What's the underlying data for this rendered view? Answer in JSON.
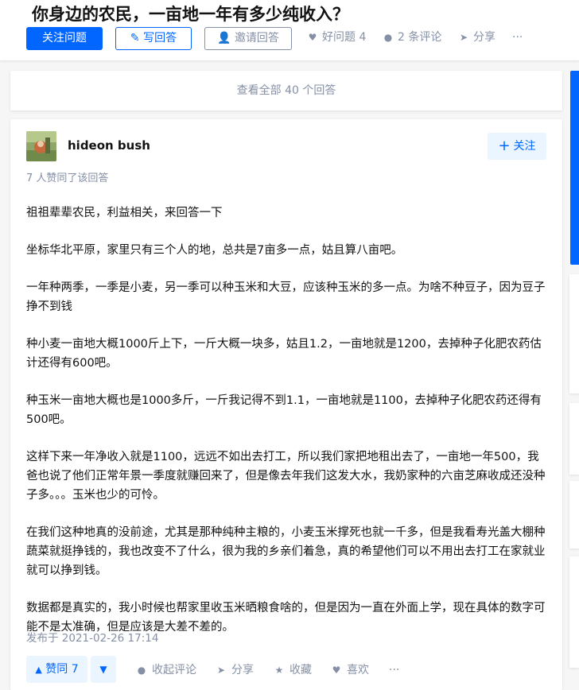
{
  "question": {
    "title": "你身边的农民，一亩地一年有多少纯收入？",
    "follow_label": "关注问题",
    "write_label": "写回答",
    "invite_label": "邀请回答",
    "good_question": "好问题 4",
    "comments": "2 条评论",
    "share": "分享",
    "more": "···"
  },
  "view_all": "查看全部 40 个回答",
  "answer": {
    "author": "hideon bush",
    "follow_label": "关注",
    "votes_line": "7 人赞同了该回答",
    "paragraphs": [
      "祖祖辈辈农民，利益相关，来回答一下",
      "坐标华北平原，家里只有三个人的地，总共是7亩多一点，姑且算八亩吧。",
      "一年种两季，一季是小麦，另一季可以种玉米和大豆，应该种玉米的多一点。为啥不种豆子，因为豆子挣不到钱",
      "种小麦一亩地大概1000斤上下，一斤大概一块多，姑且1.2，一亩地就是1200，去掉种子化肥农药估计还得有600吧。",
      "种玉米一亩地大概也是1000多斤，一斤我记得不到1.1，一亩地就是1100，去掉种子化肥农药还得有500吧。",
      "这样下来一年净收入就是1100，远远不如出去打工，所以我们家把地租出去了，一亩地一年500，我爸也说了他们正常年景一季度就赚回来了，但是像去年我们这发大水，我奶家种的六亩芝麻收成还没种子多。。。玉米也少的可怜。",
      "在我们这种地真的没前途，尤其是那种纯种主粮的，小麦玉米撑死也就一千多，但是我看寿光盖大棚种蔬菜就挺挣钱的，我也改变不了什么，很为我的乡亲们着急，真的希望他们可以不用出去打工在家就业就可以挣到钱。",
      "数据都是真实的，我小时候也帮家里收玉米晒粮食啥的，但是因为一直在外面上学，现在具体的数字可能不是太准确，但是应该是大差不差的。"
    ],
    "published": "发布于 2021-02-26 17:14",
    "vote_up": "赞同 7",
    "collapse_comments": "收起评论",
    "share": "分享",
    "collect": "收藏",
    "like": "喜欢",
    "more": "···"
  },
  "colors": {
    "brand": "#0066ff",
    "brand_light": "#ebf5ff",
    "muted": "#8590a6",
    "background": "#f6f6f6"
  },
  "icons": [
    "pen-icon",
    "invite-icon",
    "good-question-icon",
    "comment-icon",
    "share-icon",
    "more-icon",
    "plus-icon",
    "triangle-up-icon",
    "triangle-down-icon",
    "collect-icon",
    "heart-icon"
  ]
}
